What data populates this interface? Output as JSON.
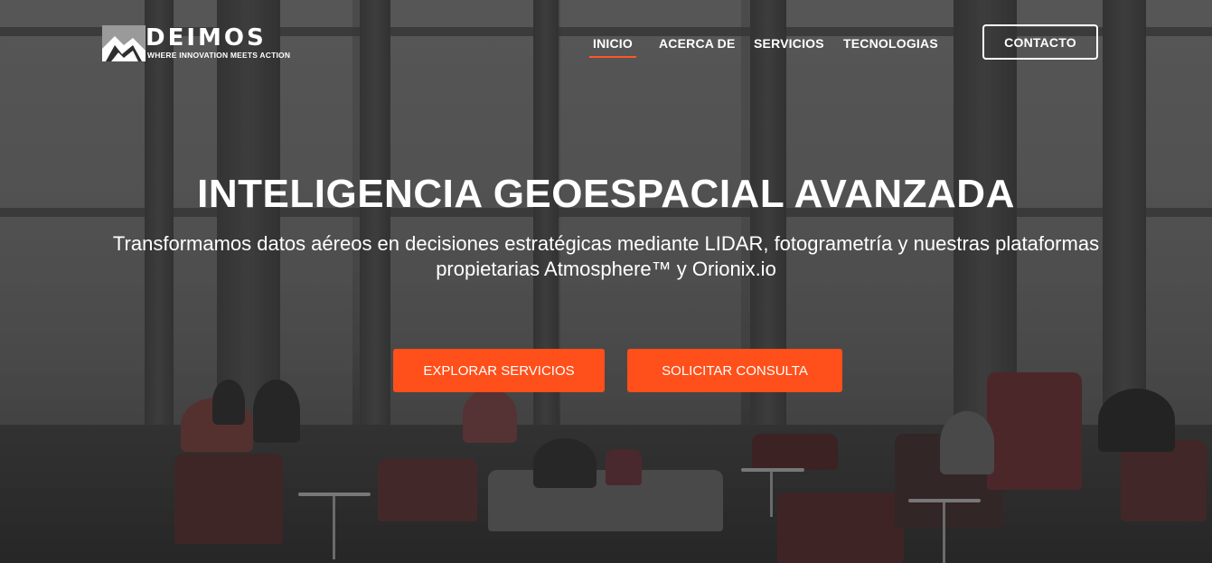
{
  "brand": {
    "name": "DEIMOS",
    "tagline": "WHERE INNOVATION MEETS ACTION",
    "logo_icon": "mountain-logo-icon"
  },
  "nav": {
    "items": [
      {
        "label": "INICIO",
        "active": true
      },
      {
        "label": "ACERCA DE",
        "active": false
      },
      {
        "label": "SERVICIOS",
        "active": false
      },
      {
        "label": "TECNOLOGIAS",
        "active": false
      }
    ],
    "contact_label": "CONTACTO"
  },
  "hero": {
    "title": "INTELIGENCIA GEOESPACIAL AVANZADA",
    "subtitle_line1": "Transformamos datos aéreos en decisiones estratégicas mediante LIDAR, fotogrametría y nuestras plataformas",
    "subtitle_line2": "propietarias Atmosphere™ y Orionix.io",
    "primary_cta": "EXPLORAR SERVICIOS",
    "secondary_cta": "SOLICITAR CONSULTA"
  },
  "colors": {
    "accent": "#ff4f1a",
    "text": "#ffffff",
    "overlay": "#3a3a3a"
  }
}
